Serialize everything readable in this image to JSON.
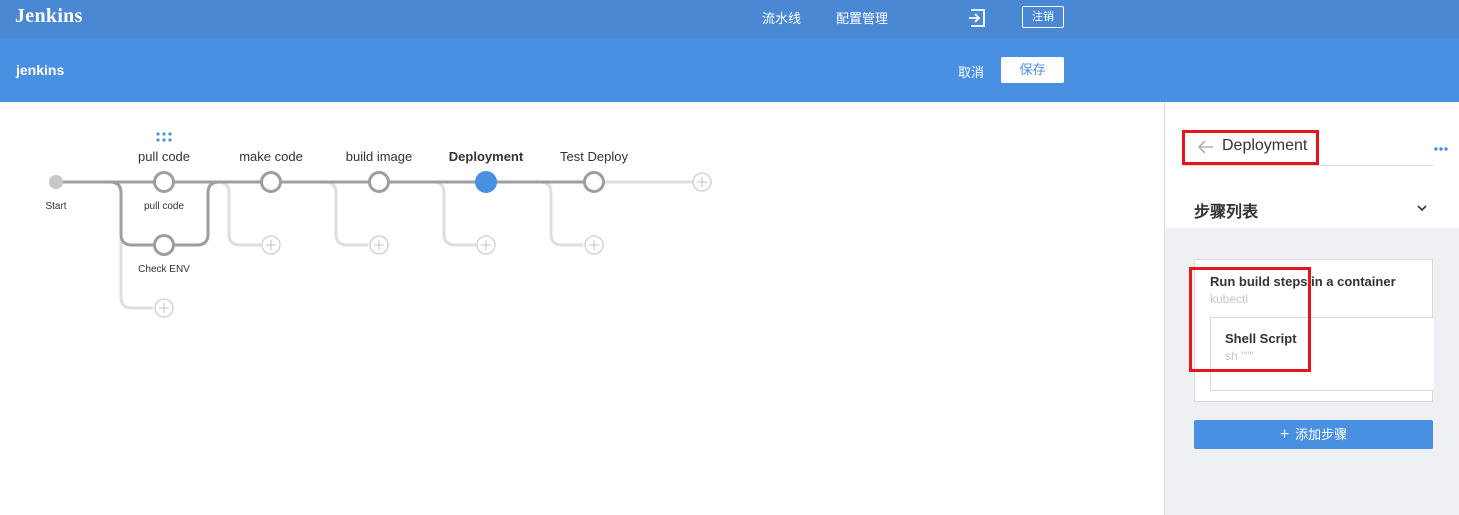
{
  "app": {
    "logo": "Jenkins"
  },
  "nav": {
    "pipeline": "流水线",
    "config": "配置管理",
    "logout": "注销"
  },
  "pipeline": {
    "name": "jenkins",
    "cancel": "取消",
    "save": "保存"
  },
  "stages": [
    {
      "label": "pull code",
      "selected": false
    },
    {
      "label": "make code",
      "selected": false
    },
    {
      "label": "build image",
      "selected": false
    },
    {
      "label": "Deployment",
      "selected": true
    },
    {
      "label": "Test Deploy",
      "selected": false
    }
  ],
  "node_labels": {
    "start": "Start",
    "pull_code": "pull code",
    "check_env": "Check ENV"
  },
  "sidebar": {
    "title": "Deployment",
    "steps_label": "步骤列表",
    "step": {
      "title": "Run build steps in a container",
      "subtitle": "kubectl"
    },
    "inner_step": {
      "title": "Shell Script",
      "subtitle": "sh \"\"\""
    },
    "add_step": "添加步骤"
  },
  "colors": {
    "topbar": "#4a88d4",
    "header": "#4a90e2",
    "accent": "#4a90e2",
    "line": "#9e9e9e",
    "highlight": "#e8141c"
  },
  "icons": [
    "exit-icon",
    "back-arrow-icon",
    "more-icon",
    "chevron-down-icon",
    "plus-icon",
    "grid-dots-icon"
  ]
}
